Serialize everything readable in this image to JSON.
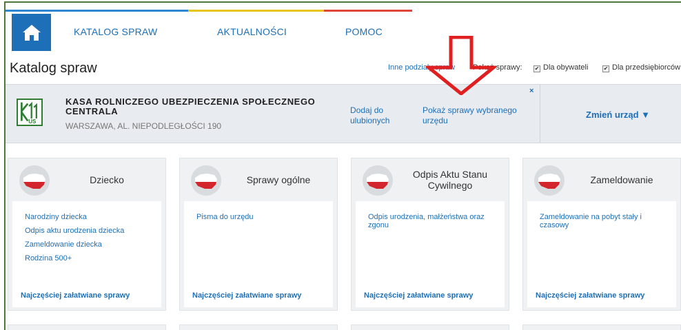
{
  "nav": {
    "home_icon": "home-icon",
    "items": [
      {
        "label": "KATALOG SPRAW"
      },
      {
        "label": "AKTUALNOŚCI"
      },
      {
        "label": "POMOC"
      }
    ],
    "colors": {
      "blue": "#2d86d1",
      "yellow": "#e8c41a",
      "red": "#e0453a"
    }
  },
  "page": {
    "title": "Katalog spraw",
    "other_divisions_link": "Inne podziały spraw",
    "show_label": "Pokaż sprawy:",
    "filters": [
      {
        "label": "Dla obywateli",
        "checked": true
      },
      {
        "label": "Dla przedsiębiorców",
        "checked": true
      }
    ]
  },
  "office": {
    "logo_icon": "krus-logo",
    "name": "KASA ROLNICZEGO UBEZPIECZENIA SPOŁECZNEGO CENTRALA",
    "address": "WARSZAWA, AL. NIEPODLEGŁOŚCI 190",
    "add_favorites": "Dodaj do ulubionych",
    "show_office_cases": "Pokaż sprawy wybranego urzędu",
    "close_icon": "×",
    "change_office": "Zmień urząd ▼"
  },
  "cards": [
    {
      "title": "Dziecko",
      "links": [
        "Narodziny dziecka",
        "Odpis aktu urodzenia dziecka",
        "Zameldowanie dziecka",
        "Rodzina 500+"
      ],
      "footer": "Najczęściej załatwiane sprawy"
    },
    {
      "title": "Sprawy ogólne",
      "links": [
        "Pisma do urzędu"
      ],
      "footer": "Najczęściej załatwiane sprawy"
    },
    {
      "title": "Odpis Aktu Stanu Cywilnego",
      "links": [
        "Odpis urodzenia, małżeństwa oraz zgonu"
      ],
      "footer": "Najczęściej załatwiane sprawy"
    },
    {
      "title": "Zameldowanie",
      "links": [
        "Zameldowanie na pobyt stały i czasowy"
      ],
      "footer": "Najczęściej załatwiane sprawy"
    }
  ],
  "annotation": {
    "color": "#e02020"
  }
}
